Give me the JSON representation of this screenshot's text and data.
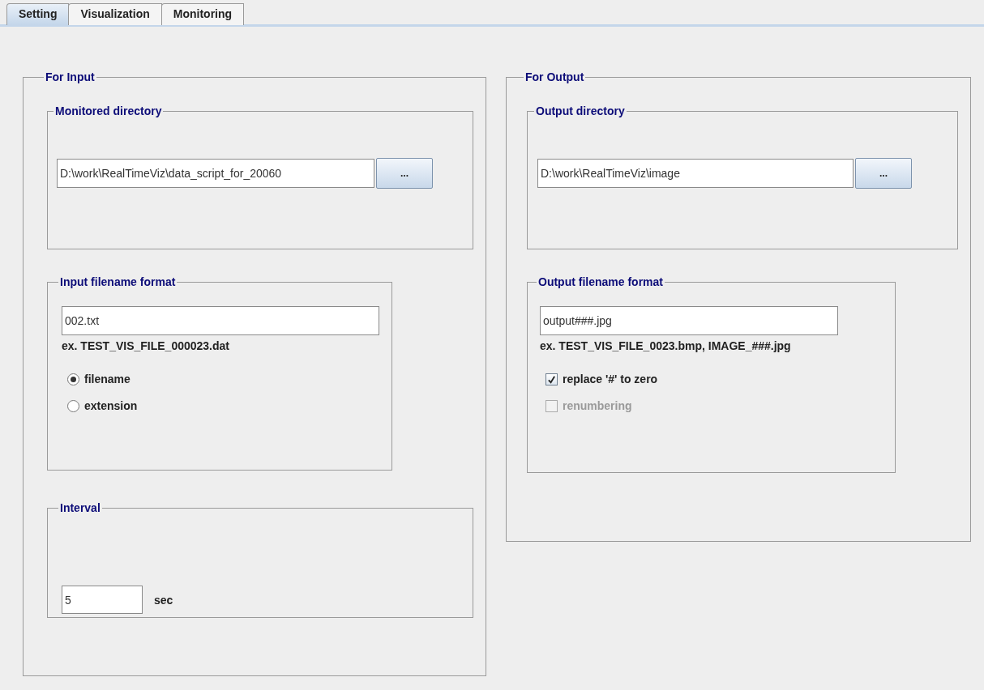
{
  "tabs": [
    {
      "label": "Setting",
      "selected": true
    },
    {
      "label": "Visualization",
      "selected": false
    },
    {
      "label": "Monitoring",
      "selected": false
    }
  ],
  "input": {
    "title": "For Input",
    "monitored_directory": {
      "title": "Monitored directory",
      "value": "D:\\work\\RealTimeViz\\data_script_for_20060",
      "button": "..."
    },
    "filename_format": {
      "title": "Input filename format",
      "value": "002.txt",
      "example": "ex. TEST_VIS_FILE_000023.dat",
      "options": [
        {
          "label": "filename",
          "selected": true
        },
        {
          "label": "extension",
          "selected": false
        }
      ]
    },
    "interval": {
      "title": "Interval",
      "value": "5",
      "unit": "sec"
    }
  },
  "output": {
    "title": "For Output",
    "output_directory": {
      "title": "Output directory",
      "value": "D:\\work\\RealTimeViz\\image",
      "button": "..."
    },
    "filename_format": {
      "title": "Output filename format",
      "value": "output###.jpg",
      "example": "ex. TEST_VIS_FILE_0023.bmp, IMAGE_###.jpg",
      "checkboxes": [
        {
          "label": "replace '#' to zero",
          "checked": true,
          "disabled": false
        },
        {
          "label": "renumbering",
          "checked": false,
          "disabled": true
        }
      ]
    }
  }
}
